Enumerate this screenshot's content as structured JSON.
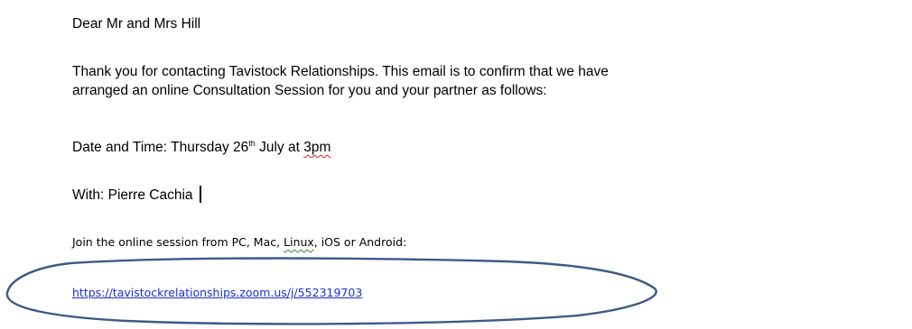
{
  "email": {
    "greeting": "Dear Mr and Mrs Hill",
    "paragraph_line1": "Thank you for contacting Tavistock Relationships. This email is to confirm that we have",
    "paragraph_line2": "arranged an online Consultation Session for you and your partner as follows:",
    "datetime_prefix": "Date and Time: Thursday 26",
    "datetime_sup": "th",
    "datetime_mid": " July at ",
    "datetime_time": "3pm",
    "with_text": "With: Pierre Cachia",
    "join_prefix": "Join the online session from PC, Mac, ",
    "join_linux": "Linux",
    "join_suffix": ", iOS or Android:",
    "meeting_url": "https://tavistockrelationships.zoom.us/j/552319703"
  },
  "annotation": {
    "ellipse_color": "#3c5a86",
    "link_color": "#1b2fd4"
  }
}
